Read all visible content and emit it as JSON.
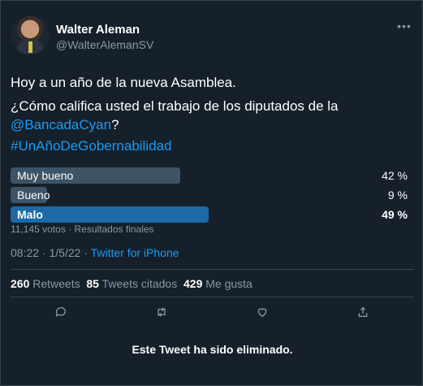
{
  "author": {
    "name": "Walter Aleman",
    "handle": "@WalterAlemanSV"
  },
  "tweet": {
    "line1": "Hoy a un año de la nueva Asamblea.",
    "line2": "¿Cómo califica usted el trabajo de los diputados de la",
    "mention": "@BancadaCyan",
    "mention_suffix": "?",
    "hashtag": "#UnAñoDeGobernabilidad"
  },
  "poll": {
    "options": [
      {
        "label": "Muy bueno",
        "percent_text": "42 %",
        "percent": 42,
        "winner": false
      },
      {
        "label": "Bueno",
        "percent_text": "9 %",
        "percent": 9,
        "winner": false
      },
      {
        "label": "Malo",
        "percent_text": "49 %",
        "percent": 49,
        "winner": true
      }
    ],
    "meta": "11,145 votos · Resultados finales"
  },
  "timestamp": "08:22 · 1/5/22 · ",
  "source": "Twitter for iPhone",
  "stats": {
    "retweets_count": "260",
    "retweets_label": "Retweets",
    "quotes_count": "85",
    "quotes_label": "Tweets citados",
    "likes_count": "429",
    "likes_label": "Me gusta"
  },
  "deleted_notice": "Este Tweet ha sido eliminado.",
  "icons": [
    "more-icon",
    "reply-icon",
    "retweet-icon",
    "like-icon",
    "share-icon"
  ],
  "colors": {
    "background": "#15202b",
    "link": "#1d9bf0",
    "muted": "#8899a6",
    "poll_bar": "#3d5466",
    "poll_winner": "#1d6aa6",
    "divider": "#38444d"
  }
}
